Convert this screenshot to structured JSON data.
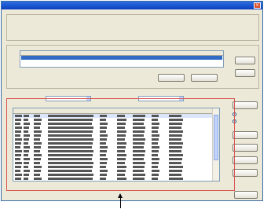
{
  "window": {
    "title": "",
    "close_glyph": "×",
    "colors": {
      "titlebar": "#0a3fc0",
      "window_bg": "#ece9d8",
      "selection": "#316ac5",
      "callout": "#d9534f"
    }
  },
  "top_group": {
    "legend": "",
    "sub_legend": "",
    "labels": [
      "",
      "",
      "",
      "",
      ""
    ]
  },
  "list_group": {
    "legend": "",
    "side_label": "",
    "buttons": [
      "",
      "",
      "",
      ""
    ]
  },
  "detail_group": {
    "legend": "",
    "filter_label_1": "",
    "filter_label_2": "",
    "side_buttons": [
      "",
      "",
      "",
      "",
      ""
    ],
    "radio_options": [
      "",
      ""
    ],
    "radio_selected_index": 0
  },
  "footer": {
    "button_label": ""
  },
  "grid": {
    "row_count": 18,
    "selected_row_index": 0
  },
  "annotation": {
    "pointer": "arrow-up-icon"
  }
}
